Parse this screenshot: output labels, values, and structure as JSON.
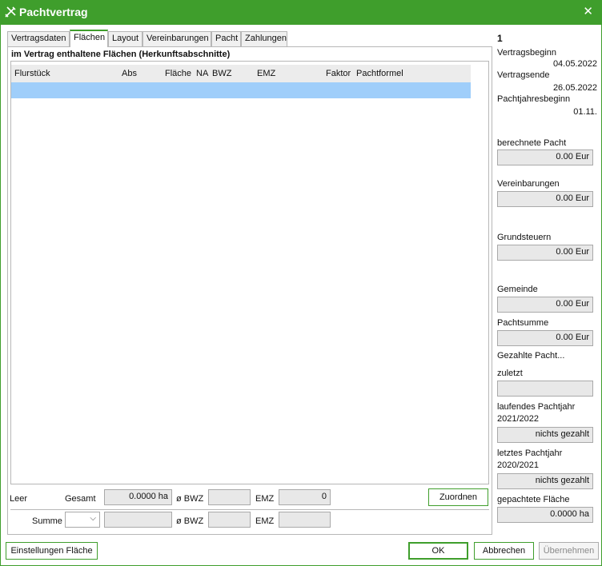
{
  "window": {
    "title": "Pachtvertrag"
  },
  "tabs": [
    "Vertragsdaten",
    "Flächen",
    "Layout",
    "Vereinbarungen",
    "Pacht",
    "Zahlungen"
  ],
  "panel": {
    "heading": "im Vertrag enthaltene Flächen (Herkunftsabschnitte)",
    "columns": [
      "Flurstück",
      "Abs",
      "Fläche",
      "NA",
      "BWZ",
      "EMZ",
      "Faktor",
      "Pachtformel"
    ]
  },
  "totals": {
    "leer_label": "Leer",
    "gesamt_label": "Gesamt",
    "gesamt_value": "0.0000 ha",
    "bwz_label": "ø BWZ",
    "bwz_value": "",
    "emz_label": "EMZ",
    "emz_value": "0",
    "assign_label": "Zuordnen",
    "summe_label": "Summe",
    "summe_select": "",
    "summe_value": "",
    "bwz2_label": "ø BWZ",
    "bwz2_value": "",
    "emz2_label": "EMZ",
    "emz2_value": ""
  },
  "sidebar": {
    "number": "1",
    "vertragsbeginn_label": "Vertragsbeginn",
    "vertragsbeginn": "04.05.2022",
    "vertragsende_label": "Vertragsende",
    "vertragsende": "26.05.2022",
    "pachtjahresbeginn_label": "Pachtjahresbeginn",
    "pachtjahresbeginn": "01.11.",
    "berechnete_label": "berechnete Pacht",
    "berechnete": "0.00 Eur",
    "vereinbarungen_label": "Vereinbarungen",
    "vereinbarungen": "0.00 Eur",
    "grundsteuern_label": "Grundsteuern",
    "grundsteuern": "0.00 Eur",
    "gemeinde_label": "Gemeinde",
    "gemeinde": "0.00 Eur",
    "pachtsumme_label": "Pachtsumme",
    "pachtsumme": "0.00 Eur",
    "gezahlt_label": "Gezahlte Pacht...",
    "zuletzt_label": "zuletzt",
    "zuletzt": "",
    "laufendes_label": "laufendes Pachtjahr",
    "laufendes_year": "2021/2022",
    "laufendes": "nichts gezahlt",
    "letztes_label": "letztes Pachtjahr",
    "letztes_year": "2020/2021",
    "letztes": "nichts gezahlt",
    "gepachtete_label": "gepachtete Fläche",
    "gepachtete": "0.0000 ha"
  },
  "buttons": {
    "settings": "Einstellungen Fläche",
    "ok": "OK",
    "cancel": "Abbrechen",
    "apply": "Übernehmen"
  }
}
